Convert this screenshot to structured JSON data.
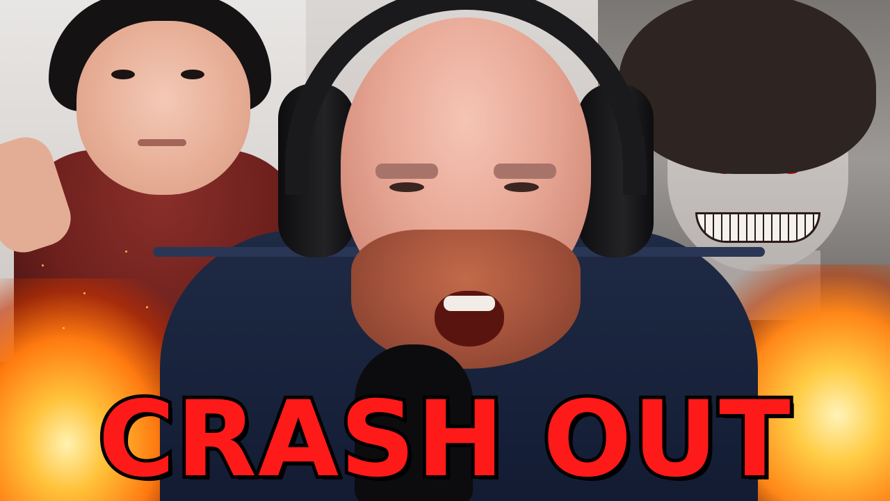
{
  "thumbnail": {
    "title": "CRASH OUT"
  }
}
